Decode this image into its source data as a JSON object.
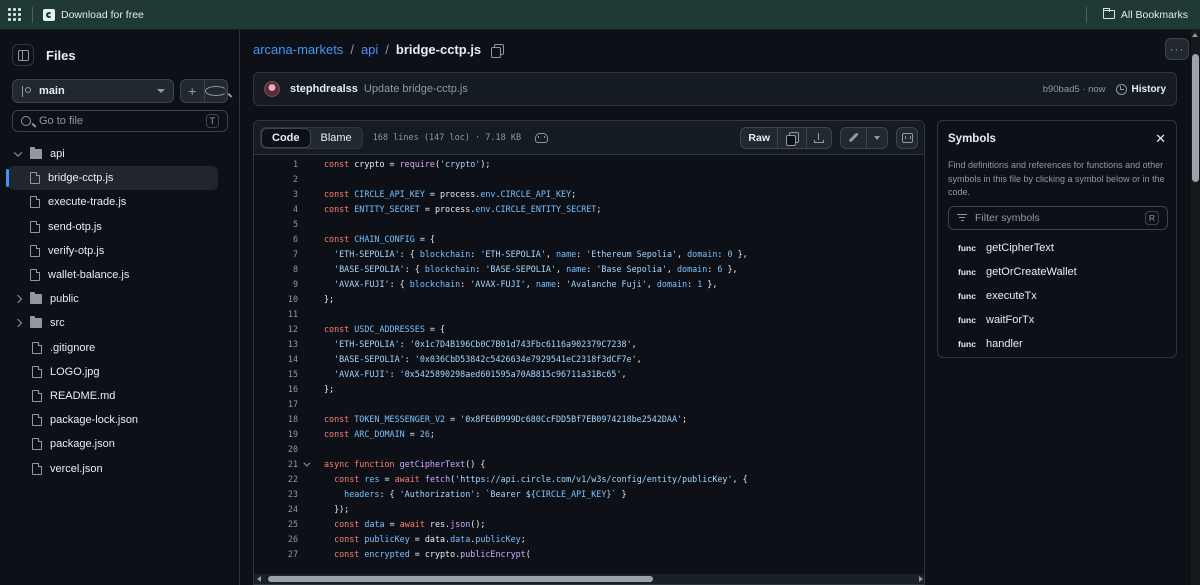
{
  "bookmarks": {
    "item_label": "Download for free",
    "all_bookmarks": "All Bookmarks"
  },
  "sidebar": {
    "title": "Files",
    "branch": "main",
    "add_label": "+",
    "goto_placeholder": "Go to file",
    "goto_shortcut": "T",
    "tree": [
      {
        "label": "api",
        "type": "dir",
        "expanded": true
      },
      {
        "label": "bridge-cctp.js",
        "type": "file",
        "selected": true
      },
      {
        "label": "execute-trade.js",
        "type": "file"
      },
      {
        "label": "send-otp.js",
        "type": "file"
      },
      {
        "label": "verify-otp.js",
        "type": "file"
      },
      {
        "label": "wallet-balance.js",
        "type": "file"
      },
      {
        "label": "public",
        "type": "dir",
        "expanded": false
      },
      {
        "label": "src",
        "type": "dir",
        "expanded": false
      },
      {
        "label": ".gitignore",
        "type": "file"
      },
      {
        "label": "LOGO.jpg",
        "type": "file"
      },
      {
        "label": "README.md",
        "type": "file"
      },
      {
        "label": "package-lock.json",
        "type": "file"
      },
      {
        "label": "package.json",
        "type": "file"
      },
      {
        "label": "vercel.json",
        "type": "file"
      }
    ]
  },
  "breadcrumb": {
    "repo": "arcana-markets",
    "sep": "/",
    "folder": "api",
    "file": "bridge-cctp.js"
  },
  "commit": {
    "user": "stephdrealss",
    "message": "Update bridge-cctp.js",
    "sha_time": "b90bad5 · now",
    "history": "History"
  },
  "toolbar": {
    "code_tab": "Code",
    "blame_tab": "Blame",
    "meta": "168 lines (147 loc) · 7.18 KB",
    "raw": "Raw"
  },
  "code_lines": [
    {
      "n": "1",
      "html": "<span class='k'>const</span> crypto = <span class='f'>require</span>(<span class='s'>'crypto'</span>);"
    },
    {
      "n": "2",
      "html": ""
    },
    {
      "n": "3",
      "html": "<span class='k'>const</span> <span class='p'>CIRCLE_API_KEY</span> = process.<span class='p'>env</span>.<span class='p'>CIRCLE_API_KEY</span>;"
    },
    {
      "n": "4",
      "html": "<span class='k'>const</span> <span class='p'>ENTITY_SECRET</span> = process.<span class='p'>env</span>.<span class='p'>CIRCLE_ENTITY_SECRET</span>;"
    },
    {
      "n": "5",
      "html": ""
    },
    {
      "n": "6",
      "html": "<span class='k'>const</span> <span class='p'>CHAIN_CONFIG</span> = {"
    },
    {
      "n": "7",
      "html": "  <span class='s'>'ETH-SEPOLIA'</span>: { <span class='p'>blockchain</span>: <span class='s'>'ETH-SEPOLIA'</span>, <span class='p'>name</span>: <span class='s'>'Ethereum Sepolia'</span>, <span class='p'>domain</span>: <span class='p'>0</span> },"
    },
    {
      "n": "8",
      "html": "  <span class='s'>'BASE-SEPOLIA'</span>: { <span class='p'>blockchain</span>: <span class='s'>'BASE-SEPOLIA'</span>, <span class='p'>name</span>: <span class='s'>'Base Sepolia'</span>, <span class='p'>domain</span>: <span class='p'>6</span> },"
    },
    {
      "n": "9",
      "html": "  <span class='s'>'AVAX-FUJI'</span>: { <span class='p'>blockchain</span>: <span class='s'>'AVAX-FUJI'</span>, <span class='p'>name</span>: <span class='s'>'Avalanche Fuji'</span>, <span class='p'>domain</span>: <span class='p'>1</span> },"
    },
    {
      "n": "10",
      "html": "};"
    },
    {
      "n": "11",
      "html": ""
    },
    {
      "n": "12",
      "html": "<span class='k'>const</span> <span class='p'>USDC_ADDRESSES</span> = {"
    },
    {
      "n": "13",
      "html": "  <span class='s'>'ETH-SEPOLIA'</span>: <span class='s'>'0x1c7D4B196Cb0C7B01d743Fbc6116a902379C7238'</span>,"
    },
    {
      "n": "14",
      "html": "  <span class='s'>'BASE-SEPOLIA'</span>: <span class='s'>'0x036CbD53842c5426634e7929541eC2318f3dCF7e'</span>,"
    },
    {
      "n": "15",
      "html": "  <span class='s'>'AVAX-FUJI'</span>: <span class='s'>'0x5425890298aed601595a70AB815c96711a31Bc65'</span>,"
    },
    {
      "n": "16",
      "html": "};"
    },
    {
      "n": "17",
      "html": ""
    },
    {
      "n": "18",
      "html": "<span class='k'>const</span> <span class='p'>TOKEN_MESSENGER_V2</span> = <span class='s'>'0x8FE6B999Dc680CcFDD5Bf7EB0974218be2542DAA'</span>;"
    },
    {
      "n": "19",
      "html": "<span class='k'>const</span> <span class='p'>ARC_DOMAIN</span> = <span class='p'>26</span>;"
    },
    {
      "n": "20",
      "html": ""
    },
    {
      "n": "21",
      "html": "<span class='k'>async</span> <span class='k'>function</span> <span class='f'>getCipherText</span>() {",
      "fold": true
    },
    {
      "n": "22",
      "html": "  <span class='k'>const</span> <span class='p'>res</span> = <span class='k'>await</span> <span class='f'>fetch</span>(<span class='s'>'https://api.circle.com/v1/w3s/config/entity/publicKey'</span>, {"
    },
    {
      "n": "23",
      "html": "    <span class='p'>headers</span>: { <span class='s'>'Authorization'</span>: <span class='s'>`Bearer ${</span><span class='p'>CIRCLE_API_KEY</span><span class='s'>}`</span> }"
    },
    {
      "n": "24",
      "html": "  });"
    },
    {
      "n": "25",
      "html": "  <span class='k'>const</span> <span class='p'>data</span> = <span class='k'>await</span> res.<span class='f'>json</span>();"
    },
    {
      "n": "26",
      "html": "  <span class='k'>const</span> <span class='p'>publicKey</span> = data.<span class='p'>data</span>.<span class='p'>publicKey</span>;"
    },
    {
      "n": "27",
      "html": "  <span class='k'>const</span> <span class='p'>encrypted</span> = crypto.<span class='f'>publicEncrypt</span>("
    }
  ],
  "symbols": {
    "title": "Symbols",
    "description": "Find definitions and references for functions and other symbols in this file by clicking a symbol below or in the code.",
    "filter_placeholder": "Filter symbols",
    "filter_shortcut": "R",
    "items": [
      {
        "kind": "func",
        "name": "getCipherText"
      },
      {
        "kind": "func",
        "name": "getOrCreateWallet"
      },
      {
        "kind": "func",
        "name": "executeTx"
      },
      {
        "kind": "func",
        "name": "waitForTx"
      },
      {
        "kind": "func",
        "name": "handler"
      }
    ]
  }
}
